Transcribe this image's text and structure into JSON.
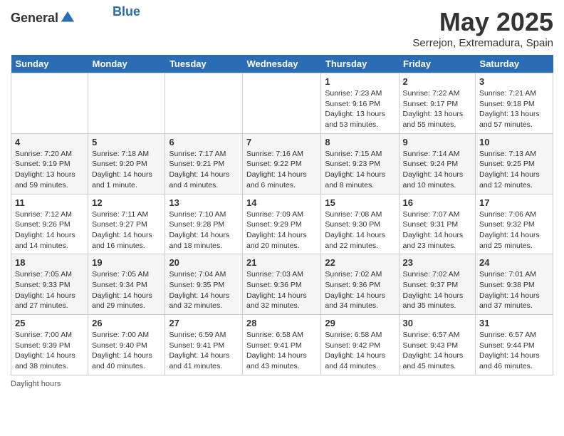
{
  "header": {
    "logo_general": "General",
    "logo_blue": "Blue",
    "month": "May 2025",
    "location": "Serrejon, Extremadura, Spain"
  },
  "days_of_week": [
    "Sunday",
    "Monday",
    "Tuesday",
    "Wednesday",
    "Thursday",
    "Friday",
    "Saturday"
  ],
  "weeks": [
    [
      {
        "day": "",
        "info": ""
      },
      {
        "day": "",
        "info": ""
      },
      {
        "day": "",
        "info": ""
      },
      {
        "day": "",
        "info": ""
      },
      {
        "day": "1",
        "sunrise": "7:23 AM",
        "sunset": "9:16 PM",
        "daylight": "13 hours and 53 minutes."
      },
      {
        "day": "2",
        "sunrise": "7:22 AM",
        "sunset": "9:17 PM",
        "daylight": "13 hours and 55 minutes."
      },
      {
        "day": "3",
        "sunrise": "7:21 AM",
        "sunset": "9:18 PM",
        "daylight": "13 hours and 57 minutes."
      }
    ],
    [
      {
        "day": "4",
        "sunrise": "7:20 AM",
        "sunset": "9:19 PM",
        "daylight": "13 hours and 59 minutes."
      },
      {
        "day": "5",
        "sunrise": "7:18 AM",
        "sunset": "9:20 PM",
        "daylight": "14 hours and 1 minute."
      },
      {
        "day": "6",
        "sunrise": "7:17 AM",
        "sunset": "9:21 PM",
        "daylight": "14 hours and 4 minutes."
      },
      {
        "day": "7",
        "sunrise": "7:16 AM",
        "sunset": "9:22 PM",
        "daylight": "14 hours and 6 minutes."
      },
      {
        "day": "8",
        "sunrise": "7:15 AM",
        "sunset": "9:23 PM",
        "daylight": "14 hours and 8 minutes."
      },
      {
        "day": "9",
        "sunrise": "7:14 AM",
        "sunset": "9:24 PM",
        "daylight": "14 hours and 10 minutes."
      },
      {
        "day": "10",
        "sunrise": "7:13 AM",
        "sunset": "9:25 PM",
        "daylight": "14 hours and 12 minutes."
      }
    ],
    [
      {
        "day": "11",
        "sunrise": "7:12 AM",
        "sunset": "9:26 PM",
        "daylight": "14 hours and 14 minutes."
      },
      {
        "day": "12",
        "sunrise": "7:11 AM",
        "sunset": "9:27 PM",
        "daylight": "14 hours and 16 minutes."
      },
      {
        "day": "13",
        "sunrise": "7:10 AM",
        "sunset": "9:28 PM",
        "daylight": "14 hours and 18 minutes."
      },
      {
        "day": "14",
        "sunrise": "7:09 AM",
        "sunset": "9:29 PM",
        "daylight": "14 hours and 20 minutes."
      },
      {
        "day": "15",
        "sunrise": "7:08 AM",
        "sunset": "9:30 PM",
        "daylight": "14 hours and 22 minutes."
      },
      {
        "day": "16",
        "sunrise": "7:07 AM",
        "sunset": "9:31 PM",
        "daylight": "14 hours and 23 minutes."
      },
      {
        "day": "17",
        "sunrise": "7:06 AM",
        "sunset": "9:32 PM",
        "daylight": "14 hours and 25 minutes."
      }
    ],
    [
      {
        "day": "18",
        "sunrise": "7:05 AM",
        "sunset": "9:33 PM",
        "daylight": "14 hours and 27 minutes."
      },
      {
        "day": "19",
        "sunrise": "7:05 AM",
        "sunset": "9:34 PM",
        "daylight": "14 hours and 29 minutes."
      },
      {
        "day": "20",
        "sunrise": "7:04 AM",
        "sunset": "9:35 PM",
        "daylight": "14 hours and 32 minutes."
      },
      {
        "day": "21",
        "sunrise": "7:03 AM",
        "sunset": "9:36 PM",
        "daylight": "14 hours and 32 minutes."
      },
      {
        "day": "22",
        "sunrise": "7:02 AM",
        "sunset": "9:36 PM",
        "daylight": "14 hours and 34 minutes."
      },
      {
        "day": "23",
        "sunrise": "7:02 AM",
        "sunset": "9:37 PM",
        "daylight": "14 hours and 35 minutes."
      },
      {
        "day": "24",
        "sunrise": "7:01 AM",
        "sunset": "9:38 PM",
        "daylight": "14 hours and 37 minutes."
      }
    ],
    [
      {
        "day": "25",
        "sunrise": "7:00 AM",
        "sunset": "9:39 PM",
        "daylight": "14 hours and 38 minutes."
      },
      {
        "day": "26",
        "sunrise": "7:00 AM",
        "sunset": "9:40 PM",
        "daylight": "14 hours and 40 minutes."
      },
      {
        "day": "27",
        "sunrise": "6:59 AM",
        "sunset": "9:41 PM",
        "daylight": "14 hours and 41 minutes."
      },
      {
        "day": "28",
        "sunrise": "6:58 AM",
        "sunset": "9:41 PM",
        "daylight": "14 hours and 43 minutes."
      },
      {
        "day": "29",
        "sunrise": "6:58 AM",
        "sunset": "9:42 PM",
        "daylight": "14 hours and 44 minutes."
      },
      {
        "day": "30",
        "sunrise": "6:57 AM",
        "sunset": "9:43 PM",
        "daylight": "14 hours and 45 minutes."
      },
      {
        "day": "31",
        "sunrise": "6:57 AM",
        "sunset": "9:44 PM",
        "daylight": "14 hours and 46 minutes."
      }
    ]
  ],
  "footer": {
    "daylight_label": "Daylight hours"
  }
}
